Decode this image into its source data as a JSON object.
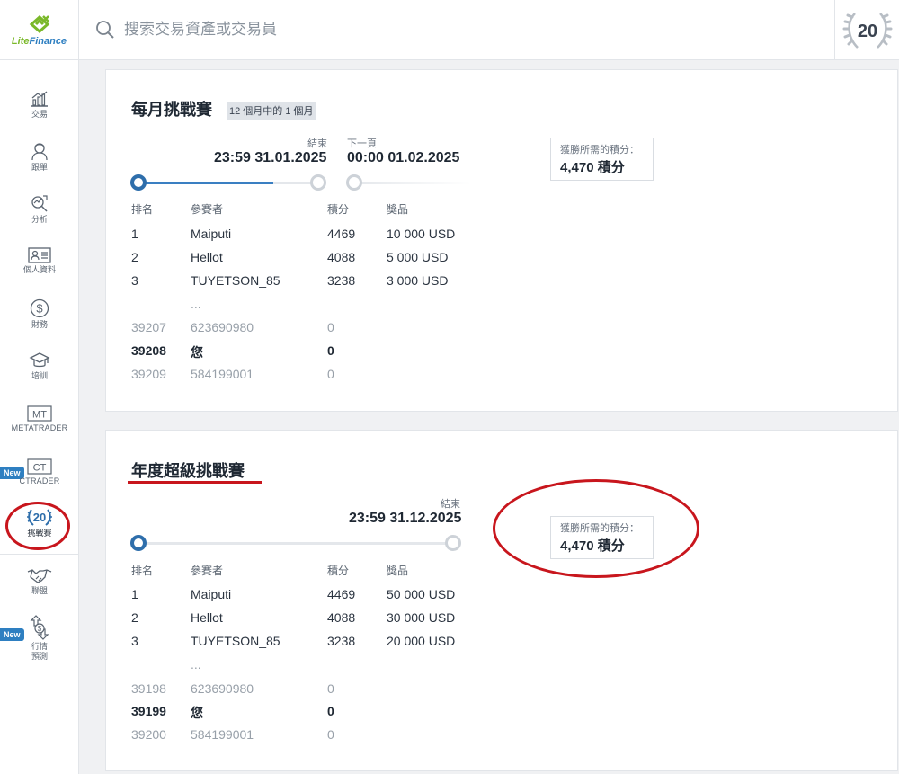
{
  "brand": {
    "logo_part1": "Lite",
    "logo_part2": "Finance",
    "brand_green": "#7ab829",
    "brand_blue": "#2e7fc1"
  },
  "search": {
    "placeholder": "搜索交易資產或交易員"
  },
  "header_badge": {
    "number": "20"
  },
  "sidebar": {
    "items": [
      {
        "label": "交易",
        "icon": "chart-icon"
      },
      {
        "label": "跟單",
        "icon": "user-icon"
      },
      {
        "label": "分析",
        "icon": "analysis-icon"
      },
      {
        "label": "個人資料",
        "icon": "profile-card-icon"
      },
      {
        "label": "財務",
        "icon": "dollar-icon"
      },
      {
        "label": "培訓",
        "icon": "graduation-cap-icon"
      },
      {
        "label": "METATRADER",
        "icon_text": "MT"
      },
      {
        "label": "CTRADER",
        "icon_text": "CT",
        "badge": "New"
      },
      {
        "label": "挑戰賽",
        "icon_text": "20"
      },
      {
        "label": "聯盟",
        "icon": "handshake-icon"
      },
      {
        "label": "行情\n預測",
        "icon": "forecast-icon",
        "badge": "New"
      }
    ]
  },
  "monthly": {
    "title": "每月挑戰賽",
    "pill": "12 個月中的 1 個月",
    "end_label": "結束",
    "end_time": "23:59 31.01.2025",
    "next_label": "下一頁",
    "next_time": "00:00 01.02.2025",
    "progress": 0.75,
    "requirement_label": "獲勝所需的積分：",
    "requirement_value": "4,470 積分",
    "columns": [
      "排名",
      "參賽者",
      "積分",
      "獎品"
    ],
    "top_rows": [
      {
        "rank": "1",
        "name": "Maiputi",
        "points": "4469",
        "prize": "10 000 USD"
      },
      {
        "rank": "2",
        "name": "Hellot",
        "points": "4088",
        "prize": "5 000 USD"
      },
      {
        "rank": "3",
        "name": "TUYETSON_85",
        "points": "3238",
        "prize": "3 000 USD"
      }
    ],
    "ellipsis": "...",
    "near_rows": [
      {
        "rank": "39207",
        "name": "623690980",
        "points": "0",
        "style": "muted"
      },
      {
        "rank": "39208",
        "name": "您",
        "points": "0",
        "style": "bold"
      },
      {
        "rank": "39209",
        "name": "584199001",
        "points": "0",
        "style": "muted"
      }
    ]
  },
  "annual": {
    "title": "年度超級挑戰賽",
    "end_label": "結束",
    "end_time": "23:59 31.12.2025",
    "progress": 0.0,
    "requirement_label": "獲勝所需的積分：",
    "requirement_value": "4,470 積分",
    "columns": [
      "排名",
      "參賽者",
      "積分",
      "獎品"
    ],
    "top_rows": [
      {
        "rank": "1",
        "name": "Maiputi",
        "points": "4469",
        "prize": "50 000 USD"
      },
      {
        "rank": "2",
        "name": "Hellot",
        "points": "4088",
        "prize": "30 000 USD"
      },
      {
        "rank": "3",
        "name": "TUYETSON_85",
        "points": "3238",
        "prize": "20 000 USD"
      }
    ],
    "ellipsis": "...",
    "near_rows": [
      {
        "rank": "39198",
        "name": "623690980",
        "points": "0",
        "style": "muted"
      },
      {
        "rank": "39199",
        "name": "您",
        "points": "0",
        "style": "bold"
      },
      {
        "rank": "39200",
        "name": "584199001",
        "points": "0",
        "style": "muted"
      }
    ]
  },
  "colors": {
    "accent": "#2e6eab",
    "annotation_red": "#c8161d"
  }
}
